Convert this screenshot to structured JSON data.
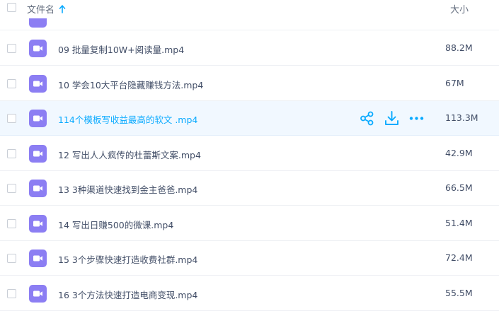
{
  "header": {
    "name_label": "文件名",
    "size_label": "大小"
  },
  "files": [
    {
      "name": "09 批量复制10W+阅读量.mp4",
      "size": "88.2M"
    },
    {
      "name": "10 学会10大平台隐藏赚钱方法.mp4",
      "size": "67M"
    },
    {
      "name": "114个模板写收益最高的软文 .mp4",
      "size": "113.3M",
      "active": true
    },
    {
      "name": "12 写出人人疯传的杜蕾斯文案.mp4",
      "size": "42.9M"
    },
    {
      "name": "13 3种渠道快速找到金主爸爸.mp4",
      "size": "66.5M"
    },
    {
      "name": "14 写出日赚500的微课.mp4",
      "size": "51.4M"
    },
    {
      "name": "15 3个步骤快速打造收费社群.mp4",
      "size": "72.4M"
    },
    {
      "name": "16 3个方法快速打造电商变现.mp4",
      "size": "55.5M"
    }
  ],
  "icons": {
    "file": "video-file-icon",
    "share": "share-icon",
    "download": "download-icon",
    "more": "more-icon",
    "sort": "sort-ascending-icon"
  },
  "colors": {
    "video_icon": "#8c7ef3",
    "accent": "#09aaff",
    "active_row_bg": "#f1f8ff",
    "text": "#424e67"
  }
}
